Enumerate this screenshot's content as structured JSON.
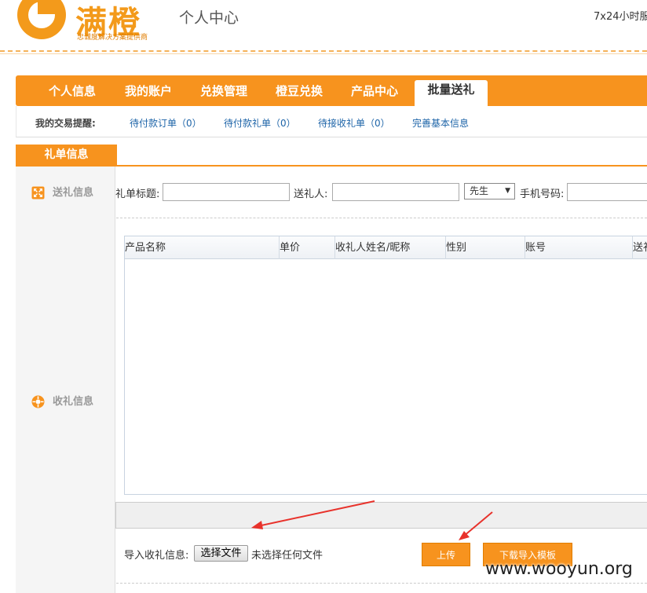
{
  "header": {
    "logo_text": "满橙",
    "logo_slogan": "忠诚度解决方案提供商",
    "page_title": "个人中心",
    "service_text": "7x24小时服"
  },
  "nav": {
    "items": [
      {
        "label": "个人信息"
      },
      {
        "label": "我的账户"
      },
      {
        "label": "兑换管理"
      },
      {
        "label": "橙豆兑换"
      },
      {
        "label": "产品中心"
      },
      {
        "label": "批量送礼",
        "active": true
      }
    ]
  },
  "reminder": {
    "label": "我的交易提醒:",
    "links": [
      {
        "label": "待付款订单（0）"
      },
      {
        "label": "待付款礼单（0）"
      },
      {
        "label": "待接收礼单（0）"
      },
      {
        "label": "完善基本信息"
      }
    ]
  },
  "section": {
    "tab_label": "礼单信息"
  },
  "sidebar": {
    "send_label": "送礼信息",
    "receive_label": "收礼信息"
  },
  "form": {
    "title_label": "礼单标题:",
    "title_value": "",
    "sender_label": "送礼人:",
    "sender_value": "",
    "salutation_selected": "先生",
    "phone_label": "手机号码:",
    "phone_value": ""
  },
  "grid": {
    "columns": [
      "产品名称",
      "单价",
      "收礼人姓名/昵称",
      "性别",
      "账号",
      "送礼"
    ]
  },
  "upload": {
    "import_label": "导入收礼信息:",
    "file_button_label": "选择文件",
    "file_status": "未选择任何文件",
    "upload_button_label": "上传",
    "download_button_label": "下载导入模板"
  },
  "watermark": "www.wooyun.org",
  "colors": {
    "accent": "#f7931e",
    "link": "#1d64a8",
    "annotation_arrow": "#e8322b"
  }
}
